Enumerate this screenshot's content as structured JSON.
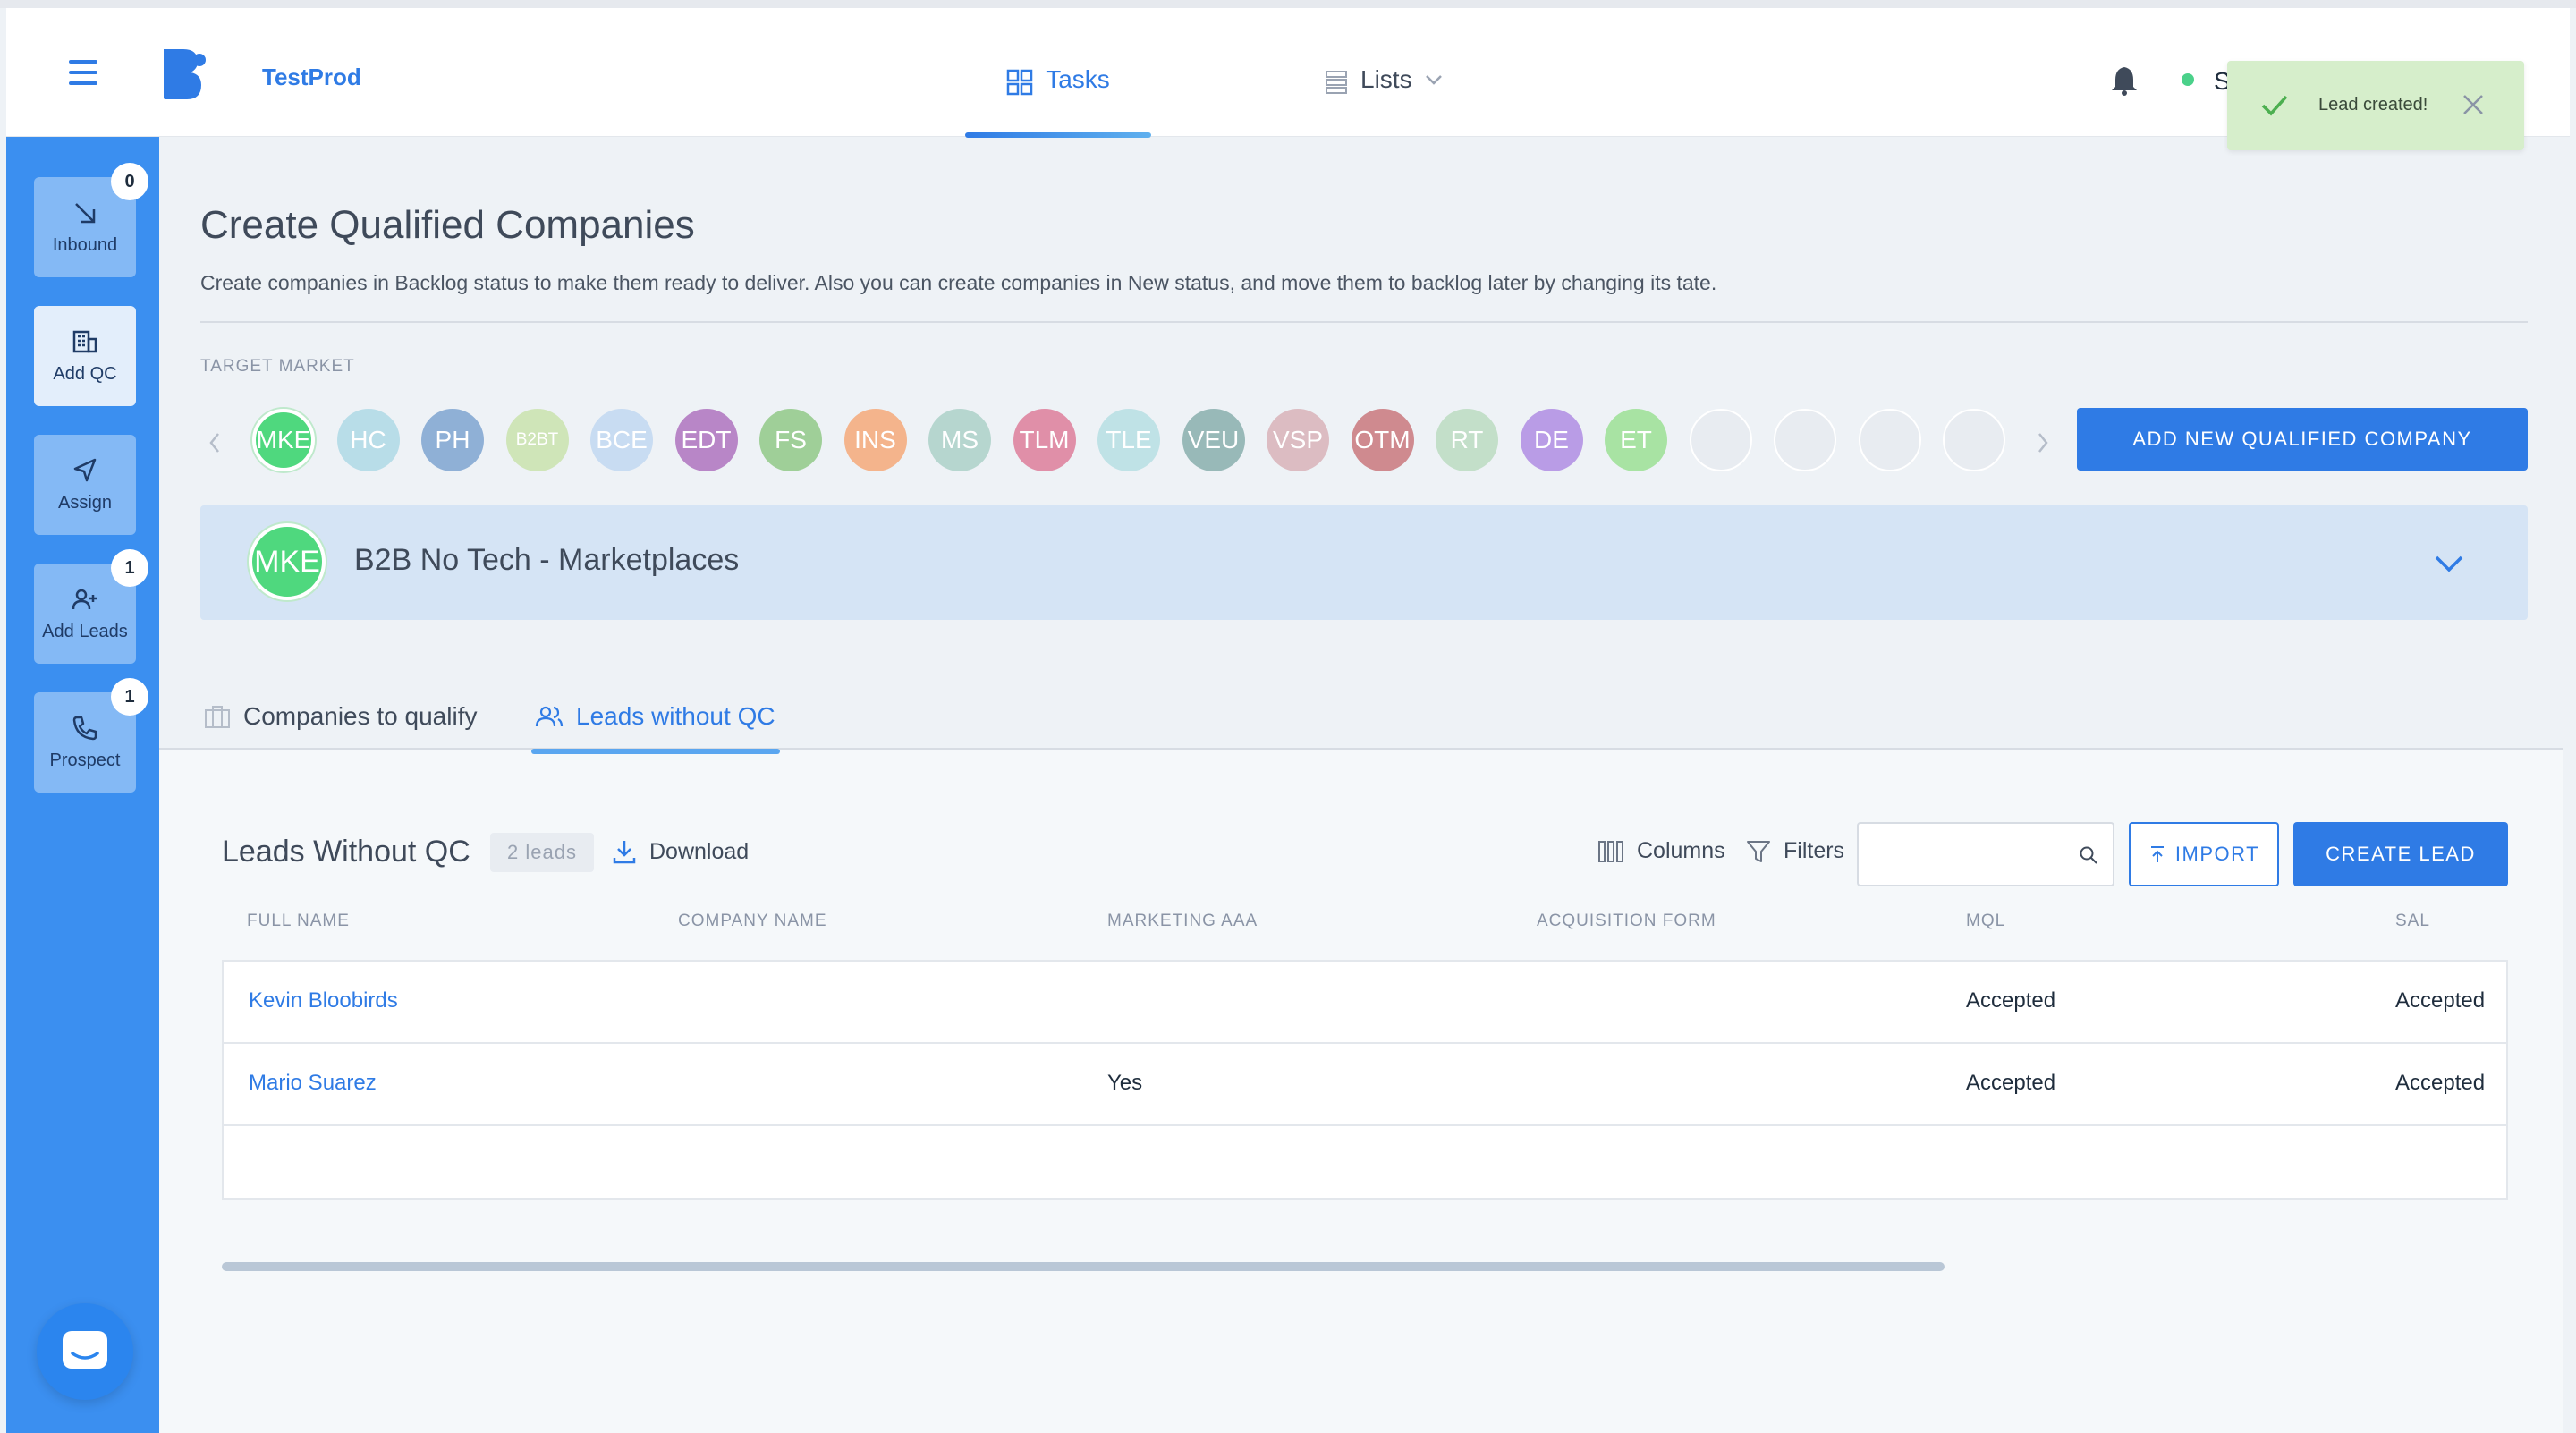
{
  "header": {
    "brand": "TestProd",
    "tabs": [
      {
        "label": "Tasks",
        "active": true
      },
      {
        "label": "Lists",
        "active": false
      }
    ],
    "user_initial": "S",
    "accent": "#2f7be5"
  },
  "toast": {
    "message": "Lead created!"
  },
  "sidebar": {
    "items": [
      {
        "label": "Inbound",
        "badge": "0"
      },
      {
        "label": "Add QC",
        "badge": ""
      },
      {
        "label": "Assign",
        "badge": ""
      },
      {
        "label": "Add Leads",
        "badge": "1"
      },
      {
        "label": "Prospect",
        "badge": "1"
      }
    ]
  },
  "page": {
    "title": "Create Qualified Companies",
    "description": "Create companies in Backlog status to make them ready to deliver. Also you can create companies in New status, and move them to backlog later by changing its tate.",
    "target_market_label": "TARGET MARKET",
    "add_button": "ADD NEW QUALIFIED COMPANY"
  },
  "markets": [
    {
      "code": "MKE",
      "color": "#4fd87e",
      "selected": true
    },
    {
      "code": "HC",
      "color": "#b8dde8"
    },
    {
      "code": "PH",
      "color": "#8fb0d6"
    },
    {
      "code": "B2BT",
      "color": "#cfe5b8"
    },
    {
      "code": "BCE",
      "color": "#c8dcf2"
    },
    {
      "code": "EDT",
      "color": "#b886c7"
    },
    {
      "code": "FS",
      "color": "#9fcf98"
    },
    {
      "code": "INS",
      "color": "#f4b48c"
    },
    {
      "code": "MS",
      "color": "#b6d6cf"
    },
    {
      "code": "TLM",
      "color": "#e08fa8"
    },
    {
      "code": "TLE",
      "color": "#bfe2e6"
    },
    {
      "code": "VEU",
      "color": "#98b9b8"
    },
    {
      "code": "VSP",
      "color": "#dcbcc2"
    },
    {
      "code": "OTM",
      "color": "#cf8a8f"
    },
    {
      "code": "RT",
      "color": "#c3dfc9"
    },
    {
      "code": "DE",
      "color": "#b99ce6"
    },
    {
      "code": "ET",
      "color": "#a8e3a3"
    }
  ],
  "selected_market": {
    "code": "MKE",
    "name": "B2B No Tech - Marketplaces",
    "color": "#4fd87e"
  },
  "tabs": [
    {
      "label": "Companies to qualify",
      "active": false
    },
    {
      "label": "Leads without QC",
      "active": true
    }
  ],
  "leads": {
    "title": "Leads Without QC",
    "count": "2 leads",
    "download": "Download",
    "columns": "Columns",
    "filters": "Filters",
    "search_placeholder": "",
    "import": "IMPORT",
    "create": "CREATE LEAD",
    "headers": [
      "FULL NAME",
      "COMPANY NAME",
      "MARKETING AAA",
      "ACQUISITION FORM",
      "MQL",
      "SAL"
    ],
    "rows": [
      {
        "full_name": "Kevin Bloobirds",
        "company": "",
        "marketing": "",
        "acquisition": "",
        "mql": "Accepted",
        "sal": "Accepted"
      },
      {
        "full_name": "Mario Suarez",
        "company": "",
        "marketing": "Yes",
        "acquisition": "",
        "mql": "Accepted",
        "sal": "Accepted"
      }
    ]
  }
}
